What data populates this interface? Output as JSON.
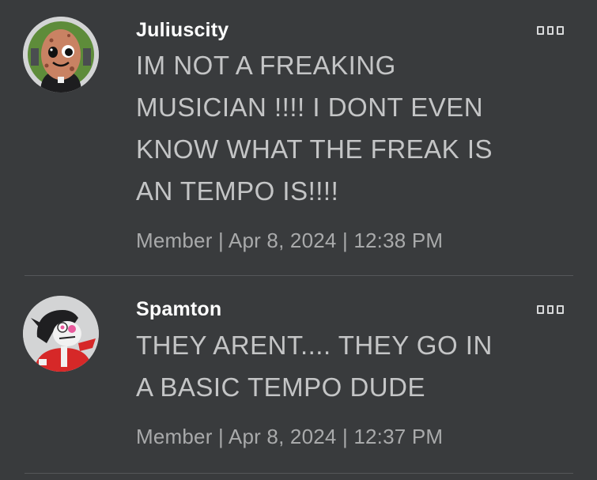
{
  "posts": [
    {
      "username": "Juliuscity",
      "content": "IM NOT A FREAKING\nMUSICIAN !!!! I DONT EVEN\nKNOW WHAT THE FREAK IS\nAN TEMPO IS!!!!",
      "meta": "Member | Apr 8, 2024 | 12:38 PM",
      "avatar_icon": "egg-character-avatar"
    },
    {
      "username": "Spamton",
      "content": "THEY ARENT.... THEY GO IN\nA BASIC TEMPO DUDE",
      "meta": "Member | Apr 8, 2024 | 12:37 PM",
      "avatar_icon": "spamton-character-avatar"
    }
  ],
  "colors": {
    "background": "#393b3d",
    "username": "#ffffff",
    "content": "#c4c5c6",
    "meta": "#a9aaab",
    "divider": "#55575a"
  }
}
